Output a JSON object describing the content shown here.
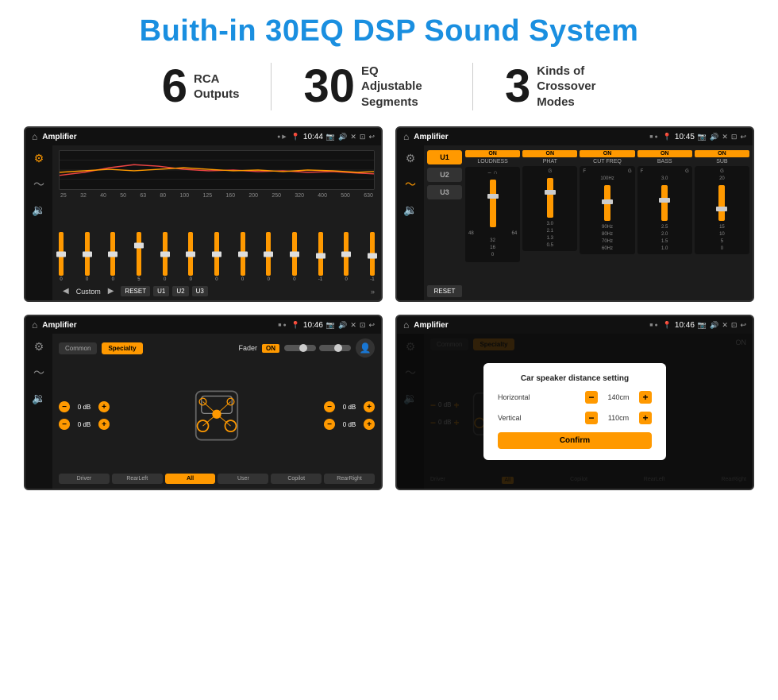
{
  "page": {
    "title": "Buith-in 30EQ DSP Sound System"
  },
  "stats": [
    {
      "number": "6",
      "text": "RCA\nOutputs"
    },
    {
      "number": "30",
      "text": "EQ Adjustable\nSegments"
    },
    {
      "number": "3",
      "text": "Kinds of\nCrossover Modes"
    }
  ],
  "screens": {
    "eq": {
      "appName": "Amplifier",
      "time": "10:44",
      "freqLabels": [
        "25",
        "32",
        "40",
        "50",
        "63",
        "80",
        "100",
        "125",
        "160",
        "200",
        "250",
        "320",
        "400",
        "500",
        "630"
      ],
      "sliderValues": [
        "0",
        "0",
        "0",
        "5",
        "0",
        "0",
        "0",
        "0",
        "0",
        "0",
        "-1",
        "0",
        "-1"
      ],
      "preset": "Custom",
      "buttons": [
        "RESET",
        "U1",
        "U2",
        "U3"
      ]
    },
    "crossover": {
      "appName": "Amplifier",
      "time": "10:45",
      "presets": [
        "U1",
        "U2",
        "U3"
      ],
      "activePreset": "U1",
      "channels": [
        "LOUDNESS",
        "PHAT",
        "CUT FREQ",
        "BASS",
        "SUB"
      ],
      "resetBtn": "RESET"
    },
    "fader": {
      "appName": "Amplifier",
      "time": "10:46",
      "tabs": [
        "Common",
        "Specialty"
      ],
      "activeTab": "Specialty",
      "faderLabel": "Fader",
      "faderOn": "ON",
      "volumes": [
        "-0 dB",
        "-0 dB",
        "-0 dB",
        "-0 dB"
      ],
      "bottomBtns": [
        "Driver",
        "RearLeft",
        "All",
        "User",
        "Copilot",
        "RearRight"
      ]
    },
    "dialog": {
      "appName": "Amplifier",
      "time": "10:46",
      "title": "Car speaker distance setting",
      "horizontal": {
        "label": "Horizontal",
        "value": "140cm"
      },
      "vertical": {
        "label": "Vertical",
        "value": "110cm"
      },
      "confirmBtn": "Confirm",
      "volumes": [
        "-0 dB",
        "-0 dB"
      ],
      "bottomBtns": [
        "Driver",
        "RearLeft",
        "All",
        "User",
        "Copilot",
        "RearRight"
      ]
    }
  }
}
